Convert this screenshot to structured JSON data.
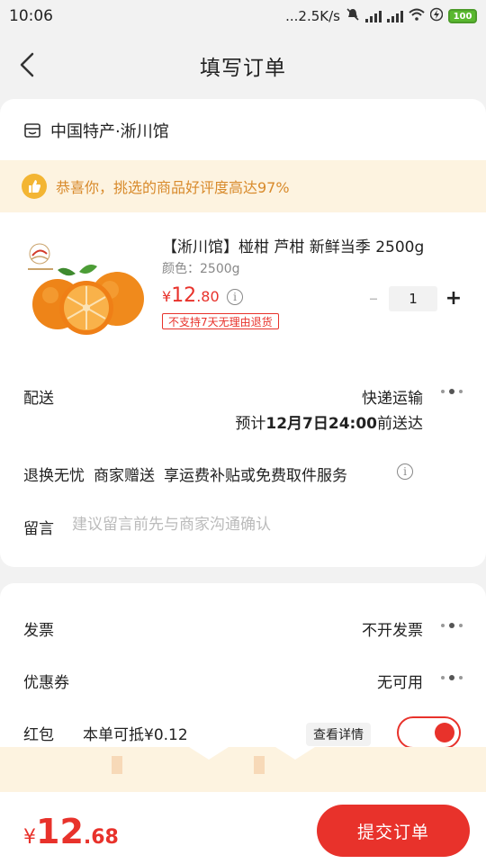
{
  "status_bar": {
    "time": "10:06",
    "network_speed": "...2.5K/s",
    "battery": "100"
  },
  "header": {
    "title": "填写订单"
  },
  "shop": {
    "name": "中国特产·淅川馆"
  },
  "praise_banner": {
    "text": "恭喜你，挑选的商品好评度高达97%"
  },
  "product": {
    "title": "【淅川馆】椪柑 芦柑 新鲜当季 2500g",
    "spec": "颜色：2500g",
    "price_yen": "¥",
    "price_int": "12",
    "price_dec": ".80",
    "return_note": "不支持7天无理由退货",
    "quantity": "1",
    "minus_label": "–",
    "plus_label": "+"
  },
  "delivery": {
    "label": "配送",
    "method": "快递运输",
    "eta_prefix": "预计",
    "eta_date": "12月7日24:00",
    "eta_suffix": "前送达"
  },
  "services": {
    "items": [
      "退换无忧",
      "商家赠送",
      "享运费补贴或免费取件服务"
    ]
  },
  "message": {
    "label": "留言",
    "placeholder": "建议留言前先与商家沟通确认",
    "value": ""
  },
  "invoice": {
    "label": "发票",
    "value": "不开发票"
  },
  "coupon": {
    "label": "优惠券",
    "value": "无可用"
  },
  "red_packet": {
    "label": "红包",
    "desc": "本单可抵¥0.12",
    "detail_button": "查看详情",
    "enabled": true
  },
  "footer": {
    "total_yen": "¥",
    "total_int": "12",
    "total_dec": ".68",
    "submit_label": "提交订单"
  },
  "colors": {
    "accent": "#e8322b",
    "banner_bg": "#fdf3e0",
    "banner_text": "#d88a2b",
    "page_bg": "#f2f2f2"
  }
}
